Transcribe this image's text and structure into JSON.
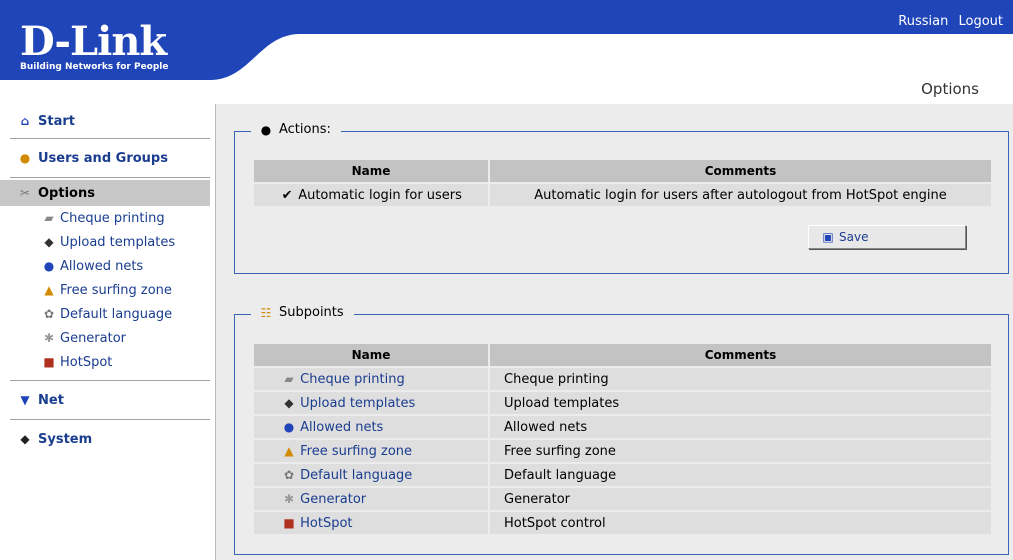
{
  "brand": {
    "logo": "D-Link",
    "tagline": "Building Networks for People"
  },
  "top_links": {
    "russian": "Russian",
    "logout": "Logout"
  },
  "page_title": "Options",
  "colors": {
    "brand_blue": "#1f45b8",
    "link": "#1a3d8f",
    "frame": "#3b64b8"
  },
  "sidebar": {
    "start": "Start",
    "users_groups": "Users and Groups",
    "options": "Options",
    "sub": [
      {
        "label": "Cheque printing",
        "icon": "printer-icon"
      },
      {
        "label": "Upload templates",
        "icon": "diamond-icon"
      },
      {
        "label": "Allowed nets",
        "icon": "globe-icon"
      },
      {
        "label": "Free surfing zone",
        "icon": "surf-icon"
      },
      {
        "label": "Default language",
        "icon": "language-icon"
      },
      {
        "label": "Generator",
        "icon": "generator-icon"
      },
      {
        "label": "HotSpot",
        "icon": "hotspot-icon"
      }
    ],
    "net": "Net",
    "system": "System"
  },
  "actions": {
    "legend": "Actions:",
    "col_name": "Name",
    "col_comments": "Comments",
    "row_name": "Automatic login for users",
    "row_comment": "Automatic login for users after autologout from HotSpot engine",
    "checked": true,
    "save": "Save"
  },
  "subpoints": {
    "legend": "Subpoints",
    "col_name": "Name",
    "col_comments": "Comments",
    "rows": [
      {
        "name": "Cheque printing",
        "comment": "Cheque printing"
      },
      {
        "name": "Upload templates",
        "comment": "Upload templates"
      },
      {
        "name": "Allowed nets",
        "comment": "Allowed nets"
      },
      {
        "name": "Free surfing zone",
        "comment": "Free surfing zone"
      },
      {
        "name": "Default language",
        "comment": "Default language"
      },
      {
        "name": "Generator",
        "comment": "Generator"
      },
      {
        "name": "HotSpot",
        "comment": "HotSpot control"
      }
    ]
  }
}
